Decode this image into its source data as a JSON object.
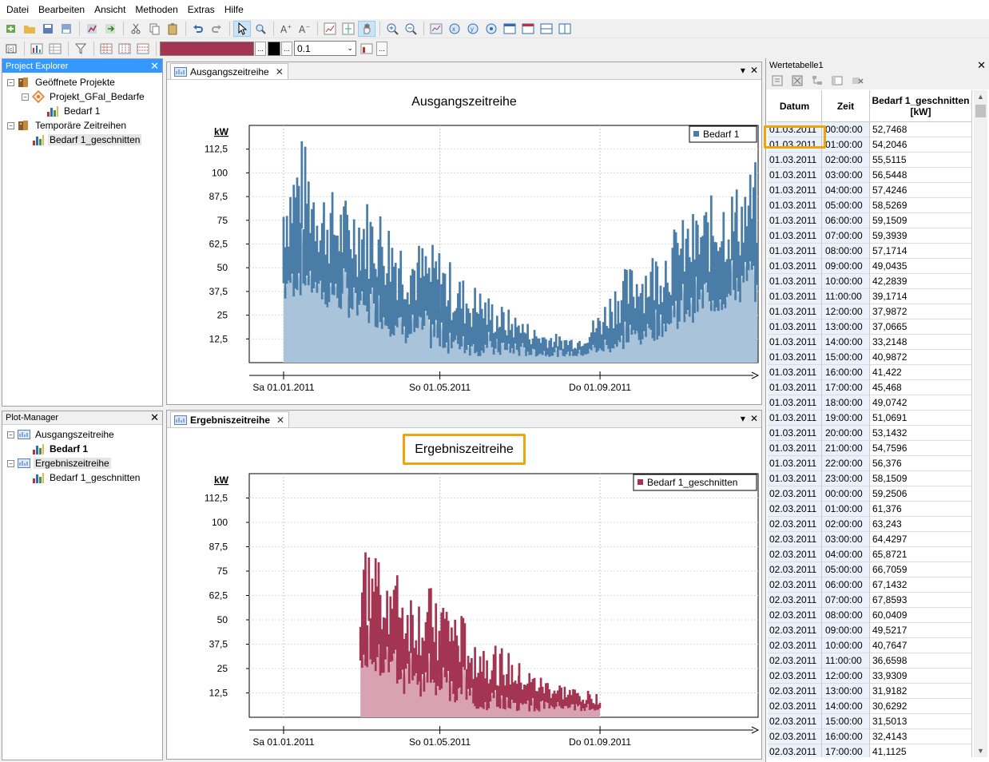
{
  "menu": [
    "Datei",
    "Bearbeiten",
    "Ansicht",
    "Methoden",
    "Extras",
    "Hilfe"
  ],
  "toolbar": {
    "line_color": "#a33553",
    "fill_color": "#000000",
    "line_width": "0.1",
    "more_label": "...",
    "dropdown_icon": "chevron-down"
  },
  "project_explorer": {
    "title": "Project Explorer",
    "items": [
      {
        "label": "Geöffnete Projekte",
        "level": 0,
        "toggle": "−",
        "icon": "folder-icon"
      },
      {
        "label": "Projekt_GFal_Bedarfe",
        "level": 1,
        "toggle": "−",
        "icon": "project-icon"
      },
      {
        "label": "Bedarf 1",
        "level": 2,
        "toggle": "",
        "icon": "bar-chart-icon"
      },
      {
        "label": "Temporäre Zeitreihen",
        "level": 0,
        "toggle": "−",
        "icon": "folder-icon"
      },
      {
        "label": "Bedarf 1_geschnitten",
        "level": 1,
        "toggle": "",
        "icon": "bar-chart-icon",
        "selected": true
      }
    ]
  },
  "plot_manager": {
    "title": "Plot-Manager",
    "items": [
      {
        "label": "Ausgangszeitreihe",
        "level": 0,
        "toggle": "−",
        "icon": "plot-icon"
      },
      {
        "label": "Bedarf 1",
        "level": 1,
        "toggle": "",
        "icon": "bar-chart-icon",
        "bold": true
      },
      {
        "label": "Ergebniszeitreihe",
        "level": 0,
        "toggle": "−",
        "icon": "plot-icon",
        "selected": true
      },
      {
        "label": "Bedarf 1_geschnitten",
        "level": 1,
        "toggle": "",
        "icon": "bar-chart-icon"
      }
    ]
  },
  "doc_top": {
    "tab": "Ausgangszeitreihe",
    "close": "✕",
    "pin": "▾",
    "x": "✕"
  },
  "doc_bottom": {
    "tab": "Ergebniszeitreihe",
    "close": "✕",
    "pin": "▾",
    "x": "✕"
  },
  "chart_data": [
    {
      "type": "area",
      "title": "Ausgangszeitreihe",
      "ylabel": "kW",
      "yticks": [
        "112,5",
        "100",
        "87,5",
        "75",
        "62,5",
        "50",
        "37,5",
        "25",
        "12,5"
      ],
      "ytick_values": [
        112.5,
        100,
        87.5,
        75,
        62.5,
        50,
        37.5,
        25,
        12.5
      ],
      "xticks": [
        "Sa 01.01.2011",
        "So 01.05.2011",
        "Do 01.09.2011"
      ],
      "ylim": [
        0,
        125
      ],
      "grid": true,
      "legend": "top-right",
      "series": [
        {
          "name": "Bedarf 1",
          "color": "#4a7ca8",
          "fill": "#a9c3da",
          "x": [
            "2011-01-01",
            "2011-01-15",
            "2011-02-01",
            "2011-02-15",
            "2011-03-01",
            "2011-03-15",
            "2011-04-01",
            "2011-04-15",
            "2011-05-01",
            "2011-05-15",
            "2011-06-01",
            "2011-06-15",
            "2011-07-01",
            "2011-07-15",
            "2011-08-01",
            "2011-08-15",
            "2011-09-01",
            "2011-09-15",
            "2011-10-01",
            "2011-10-15",
            "2011-11-01",
            "2011-11-15",
            "2011-12-01",
            "2011-12-15",
            "2011-12-31"
          ],
          "max": [
            100,
            120,
            95,
            88,
            90,
            85,
            70,
            65,
            62,
            48,
            40,
            32,
            25,
            18,
            15,
            14,
            28,
            48,
            55,
            62,
            75,
            82,
            92,
            95,
            108
          ],
          "min": [
            30,
            35,
            28,
            25,
            20,
            18,
            10,
            8,
            5,
            4,
            3,
            3,
            3,
            3,
            3,
            3,
            4,
            5,
            8,
            12,
            18,
            22,
            25,
            30,
            32
          ]
        }
      ]
    },
    {
      "type": "area",
      "title": "Ergebniszeitreihe",
      "ylabel": "kW",
      "yticks": [
        "112,5",
        "100",
        "87,5",
        "75",
        "62,5",
        "50",
        "37,5",
        "25",
        "12,5"
      ],
      "ytick_values": [
        112.5,
        100,
        87.5,
        75,
        62.5,
        50,
        37.5,
        25,
        12.5
      ],
      "xticks": [
        "Sa 01.01.2011",
        "So 01.05.2011",
        "Do 01.09.2011"
      ],
      "ylim": [
        0,
        125
      ],
      "grid": true,
      "legend": "top-right",
      "series": [
        {
          "name": "Bedarf 1_geschnitten",
          "color": "#a33553",
          "fill": "#d9a2b3",
          "x": [
            "2011-03-01",
            "2011-03-15",
            "2011-04-01",
            "2011-04-15",
            "2011-05-01",
            "2011-05-15",
            "2011-06-01",
            "2011-06-15",
            "2011-07-01",
            "2011-07-15",
            "2011-08-01",
            "2011-08-15",
            "2011-09-01"
          ],
          "max": [
            85,
            90,
            72,
            65,
            68,
            55,
            42,
            38,
            28,
            22,
            18,
            15,
            12
          ],
          "min": [
            25,
            22,
            12,
            10,
            8,
            6,
            4,
            3,
            3,
            3,
            3,
            3,
            3
          ]
        }
      ]
    }
  ],
  "table": {
    "title": "Wertetabelle1",
    "headers": [
      "Datum",
      "Zeit",
      "Bedarf 1_geschnitten [kW]"
    ],
    "rows": [
      [
        "01.03.2011",
        "00:00:00",
        "52,7468"
      ],
      [
        "01.03.2011",
        "01:00:00",
        "54,2046"
      ],
      [
        "01.03.2011",
        "02:00:00",
        "55,5115"
      ],
      [
        "01.03.2011",
        "03:00:00",
        "56,5448"
      ],
      [
        "01.03.2011",
        "04:00:00",
        "57,4246"
      ],
      [
        "01.03.2011",
        "05:00:00",
        "58,5269"
      ],
      [
        "01.03.2011",
        "06:00:00",
        "59,1509"
      ],
      [
        "01.03.2011",
        "07:00:00",
        "59,3939"
      ],
      [
        "01.03.2011",
        "08:00:00",
        "57,1714"
      ],
      [
        "01.03.2011",
        "09:00:00",
        "49,0435"
      ],
      [
        "01.03.2011",
        "10:00:00",
        "42,2839"
      ],
      [
        "01.03.2011",
        "11:00:00",
        "39,1714"
      ],
      [
        "01.03.2011",
        "12:00:00",
        "37,9872"
      ],
      [
        "01.03.2011",
        "13:00:00",
        "37,0665"
      ],
      [
        "01.03.2011",
        "14:00:00",
        "33,2148"
      ],
      [
        "01.03.2011",
        "15:00:00",
        "40,9872"
      ],
      [
        "01.03.2011",
        "16:00:00",
        "41,422"
      ],
      [
        "01.03.2011",
        "17:00:00",
        "45,468"
      ],
      [
        "01.03.2011",
        "18:00:00",
        "49,0742"
      ],
      [
        "01.03.2011",
        "19:00:00",
        "51,0691"
      ],
      [
        "01.03.2011",
        "20:00:00",
        "53,1432"
      ],
      [
        "01.03.2011",
        "21:00:00",
        "54,7596"
      ],
      [
        "01.03.2011",
        "22:00:00",
        "56,376"
      ],
      [
        "01.03.2011",
        "23:00:00",
        "58,1509"
      ],
      [
        "02.03.2011",
        "00:00:00",
        "59,2506"
      ],
      [
        "02.03.2011",
        "01:00:00",
        "61,376"
      ],
      [
        "02.03.2011",
        "02:00:00",
        "63,243"
      ],
      [
        "02.03.2011",
        "03:00:00",
        "64,4297"
      ],
      [
        "02.03.2011",
        "04:00:00",
        "65,8721"
      ],
      [
        "02.03.2011",
        "05:00:00",
        "66,7059"
      ],
      [
        "02.03.2011",
        "06:00:00",
        "67,1432"
      ],
      [
        "02.03.2011",
        "07:00:00",
        "67,8593"
      ],
      [
        "02.03.2011",
        "08:00:00",
        "60,0409"
      ],
      [
        "02.03.2011",
        "09:00:00",
        "49,5217"
      ],
      [
        "02.03.2011",
        "10:00:00",
        "40,7647"
      ],
      [
        "02.03.2011",
        "11:00:00",
        "36,6598"
      ],
      [
        "02.03.2011",
        "12:00:00",
        "33,9309"
      ],
      [
        "02.03.2011",
        "13:00:00",
        "31,9182"
      ],
      [
        "02.03.2011",
        "14:00:00",
        "30,6292"
      ],
      [
        "02.03.2011",
        "15:00:00",
        "31,5013"
      ],
      [
        "02.03.2011",
        "16:00:00",
        "32,4143"
      ],
      [
        "02.03.2011",
        "17:00:00",
        "41,1125"
      ]
    ]
  }
}
